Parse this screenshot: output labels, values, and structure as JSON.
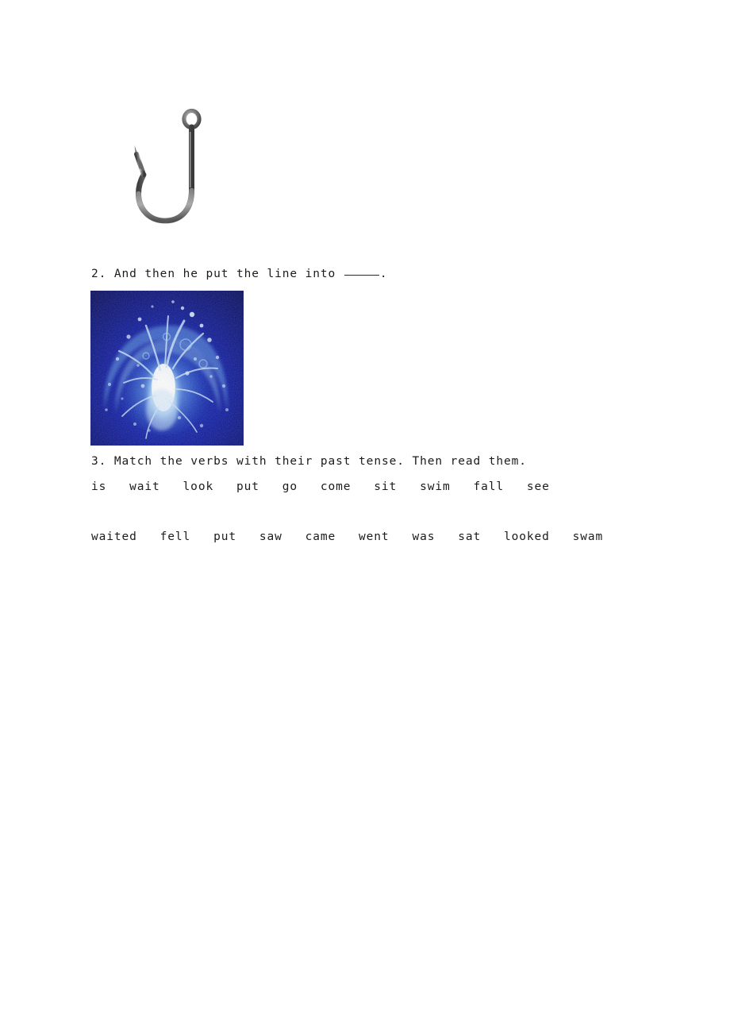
{
  "page": {
    "background_color": "#ffffff",
    "text_color": "#1c1c1c"
  },
  "figures": [
    {
      "name": "fish-hook-photo",
      "alt": "fishing hook",
      "colors": {
        "metal_dark": "#4a4a4a",
        "metal_mid": "#6e6e6e",
        "metal_light": "#a9a9a9",
        "highlight": "#d6d6d6"
      }
    },
    {
      "name": "water-splash-photo",
      "alt": "water splash in dark blue water",
      "colors": {
        "background_deep": "#050b6e",
        "background_blue": "#0d1aa8",
        "mid_blue": "#2b5fd4",
        "light_blue": "#8fc4f2",
        "core_white": "#ffffff"
      }
    }
  ],
  "questions": {
    "q2": {
      "number": "2.",
      "text_before_blank": "And then he put the line into",
      "blank": "_____",
      "text_after_blank": "."
    },
    "q3": {
      "number": "3.",
      "text": "Match the verbs with their past tense. Then read them."
    }
  },
  "verbs": {
    "present": [
      "is",
      "wait",
      "look",
      "put",
      "go",
      "come",
      "sit",
      "swim",
      "fall",
      "see"
    ],
    "past": [
      "waited",
      "fell",
      "put",
      "saw",
      "came",
      "went",
      "was",
      "sat",
      "looked",
      "swam"
    ],
    "present_line": "is   wait   look   put   go   come   sit   swim   fall   see",
    "past_line": "waited   fell   put   saw   came   went   was   sat   looked   swam"
  },
  "lines": {
    "q2_full": "2. And then he put the line into",
    "q3_full": "3. Match the verbs with their past tense. Then read them."
  }
}
